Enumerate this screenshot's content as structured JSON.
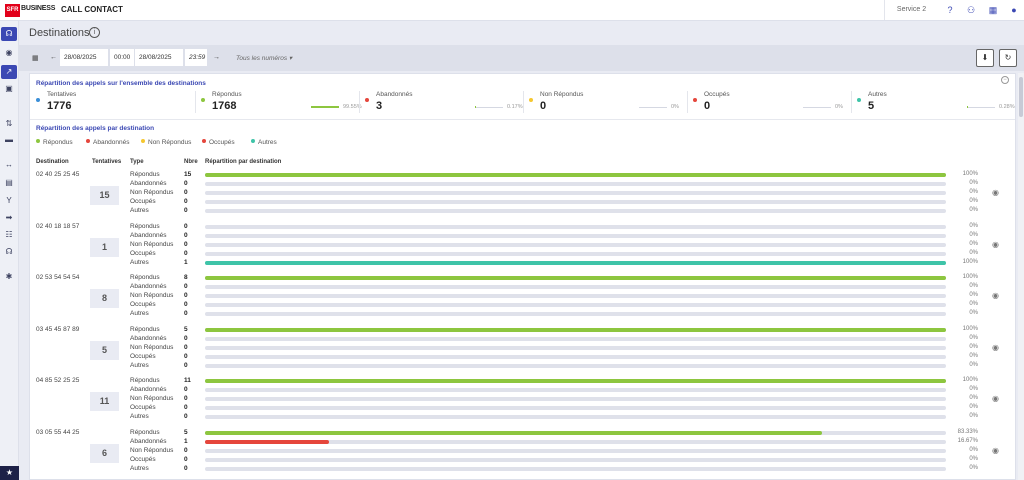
{
  "header": {
    "logo_text": "SFR",
    "brand": "BUSINESS",
    "app_title": "CALL CONTACT",
    "service": "Service 2"
  },
  "page": {
    "title": "Destinations"
  },
  "filters": {
    "date_from": "28/08/2025",
    "time_from": "00:00",
    "date_to": "28/08/2025",
    "time_to": "23:59",
    "numbers_select": "Tous les numéros"
  },
  "summary": {
    "title": "Répartition des appels sur l'ensemble des destinations",
    "stats": [
      {
        "label": "Tentatives",
        "value": "1776",
        "color": "#3b8fd8",
        "pct": null
      },
      {
        "label": "Répondus",
        "value": "1768",
        "color": "#8dc63f",
        "pct": "99.55%",
        "fill": 0.9955
      },
      {
        "label": "Abandonnés",
        "value": "3",
        "color": "#e5463c",
        "pct": "0.17%",
        "fill": 0.0017
      },
      {
        "label": "Non Répondus",
        "value": "0",
        "color": "#f5c730",
        "pct": "0%",
        "fill": 0
      },
      {
        "label": "Occupés",
        "value": "0",
        "color": "#e5463c",
        "pct": "0%",
        "fill": 0
      },
      {
        "label": "Autres",
        "value": "5",
        "color": "#3ec4a8",
        "pct": "0.28%",
        "fill": 0.0028
      }
    ]
  },
  "per_destination": {
    "title": "Répartition des appels par destination",
    "legend": [
      {
        "label": "Répondus",
        "color": "#8dc63f"
      },
      {
        "label": "Abandonnés",
        "color": "#e5463c"
      },
      {
        "label": "Non Répondus",
        "color": "#f5c730"
      },
      {
        "label": "Occupés",
        "color": "#e5463c"
      },
      {
        "label": "Autres",
        "color": "#3ec4a8"
      }
    ],
    "columns": {
      "destination": "Destination",
      "tentatives": "Tentatives",
      "type": "Type",
      "nbre": "Nbre",
      "repartition": "Répartition par destination"
    },
    "groups": [
      {
        "destination": "02 40 25 25 45",
        "total": "15",
        "rows": [
          {
            "type": "Répondus",
            "count": "15",
            "pct": "100%",
            "fill": 1.0,
            "color": "#8dc63f"
          },
          {
            "type": "Abandonnés",
            "count": "0",
            "pct": "0%",
            "fill": 0,
            "color": "#e5463c"
          },
          {
            "type": "Non Répondus",
            "count": "0",
            "pct": "0%",
            "fill": 0,
            "color": "#f5c730"
          },
          {
            "type": "Occupés",
            "count": "0",
            "pct": "0%",
            "fill": 0,
            "color": "#e5463c"
          },
          {
            "type": "Autres",
            "count": "0",
            "pct": "0%",
            "fill": 0,
            "color": "#3ec4a8"
          }
        ]
      },
      {
        "destination": "02 40 18 18 57",
        "total": "1",
        "rows": [
          {
            "type": "Répondus",
            "count": "0",
            "pct": "0%",
            "fill": 0,
            "color": "#8dc63f"
          },
          {
            "type": "Abandonnés",
            "count": "0",
            "pct": "0%",
            "fill": 0,
            "color": "#e5463c"
          },
          {
            "type": "Non Répondus",
            "count": "0",
            "pct": "0%",
            "fill": 0,
            "color": "#f5c730"
          },
          {
            "type": "Occupés",
            "count": "0",
            "pct": "0%",
            "fill": 0,
            "color": "#e5463c"
          },
          {
            "type": "Autres",
            "count": "1",
            "pct": "100%",
            "fill": 1.0,
            "color": "#3ec4a8"
          }
        ]
      },
      {
        "destination": "02 53 54 54 54",
        "total": "8",
        "rows": [
          {
            "type": "Répondus",
            "count": "8",
            "pct": "100%",
            "fill": 1.0,
            "color": "#8dc63f"
          },
          {
            "type": "Abandonnés",
            "count": "0",
            "pct": "0%",
            "fill": 0,
            "color": "#e5463c"
          },
          {
            "type": "Non Répondus",
            "count": "0",
            "pct": "0%",
            "fill": 0,
            "color": "#f5c730"
          },
          {
            "type": "Occupés",
            "count": "0",
            "pct": "0%",
            "fill": 0,
            "color": "#e5463c"
          },
          {
            "type": "Autres",
            "count": "0",
            "pct": "0%",
            "fill": 0,
            "color": "#3ec4a8"
          }
        ]
      },
      {
        "destination": "03 45 45 87 89",
        "total": "5",
        "rows": [
          {
            "type": "Répondus",
            "count": "5",
            "pct": "100%",
            "fill": 1.0,
            "color": "#8dc63f"
          },
          {
            "type": "Abandonnés",
            "count": "0",
            "pct": "0%",
            "fill": 0,
            "color": "#e5463c"
          },
          {
            "type": "Non Répondus",
            "count": "0",
            "pct": "0%",
            "fill": 0,
            "color": "#f5c730"
          },
          {
            "type": "Occupés",
            "count": "0",
            "pct": "0%",
            "fill": 0,
            "color": "#e5463c"
          },
          {
            "type": "Autres",
            "count": "0",
            "pct": "0%",
            "fill": 0,
            "color": "#3ec4a8"
          }
        ]
      },
      {
        "destination": "04 85 52 25 25",
        "total": "11",
        "rows": [
          {
            "type": "Répondus",
            "count": "11",
            "pct": "100%",
            "fill": 1.0,
            "color": "#8dc63f"
          },
          {
            "type": "Abandonnés",
            "count": "0",
            "pct": "0%",
            "fill": 0,
            "color": "#e5463c"
          },
          {
            "type": "Non Répondus",
            "count": "0",
            "pct": "0%",
            "fill": 0,
            "color": "#f5c730"
          },
          {
            "type": "Occupés",
            "count": "0",
            "pct": "0%",
            "fill": 0,
            "color": "#e5463c"
          },
          {
            "type": "Autres",
            "count": "0",
            "pct": "0%",
            "fill": 0,
            "color": "#3ec4a8"
          }
        ]
      },
      {
        "destination": "03 05 55 44 25",
        "total": "6",
        "rows": [
          {
            "type": "Répondus",
            "count": "5",
            "pct": "83.33%",
            "fill": 0.8333,
            "color": "#8dc63f"
          },
          {
            "type": "Abandonnés",
            "count": "1",
            "pct": "16.67%",
            "fill": 0.1667,
            "color": "#e5463c"
          },
          {
            "type": "Non Répondus",
            "count": "0",
            "pct": "0%",
            "fill": 0,
            "color": "#f5c730"
          },
          {
            "type": "Occupés",
            "count": "0",
            "pct": "0%",
            "fill": 0,
            "color": "#e5463c"
          },
          {
            "type": "Autres",
            "count": "0",
            "pct": "0%",
            "fill": 0,
            "color": "#3ec4a8"
          }
        ]
      }
    ]
  }
}
